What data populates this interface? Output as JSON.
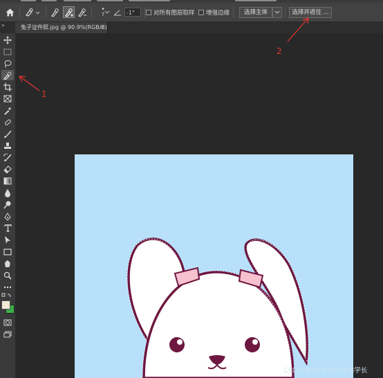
{
  "options_bar": {
    "angle_value": "-1°",
    "brush_size": "7",
    "sample_all_layers_label": "对所有图层取样",
    "enhance_edge_label": "增强边缘",
    "select_subject_label": "选择主体",
    "select_and_mask_label": "选择并遮住 ..."
  },
  "document_tab": {
    "title": "兔子证件照.jpg @ 90.9%(RGB/8)",
    "close": "×"
  },
  "annotations": {
    "arrow1_label": "1",
    "arrow2_label": "2",
    "color": "#e0332f"
  },
  "canvas": {
    "background_color": "#b8e0fb"
  },
  "watermark": "CSDN @白T豆豆的小潘学长",
  "icons": {
    "home": "home-icon",
    "quick_selection": "quick-selection-icon",
    "move": "move-icon",
    "marquee": "marquee-icon",
    "lasso": "lasso-icon",
    "crop": "crop-icon",
    "frame": "frame-icon",
    "eyedropper": "eyedropper-icon",
    "healing": "healing-brush-icon",
    "brush": "brush-icon",
    "stamp": "clone-stamp-icon",
    "history_brush": "history-brush-icon",
    "eraser": "eraser-icon",
    "gradient": "gradient-icon",
    "blur": "blur-icon",
    "dodge": "dodge-icon",
    "pen": "pen-icon",
    "type": "type-icon",
    "path_select": "path-selection-icon",
    "rectangle": "rectangle-icon",
    "hand": "hand-icon",
    "zoom": "zoom-icon",
    "more": "more-tools-icon",
    "quick_mask": "quick-mask-icon",
    "screen_mode": "screen-mode-icon"
  },
  "colors": {
    "foreground": "#f4ead8",
    "background": "#3bb04a"
  }
}
